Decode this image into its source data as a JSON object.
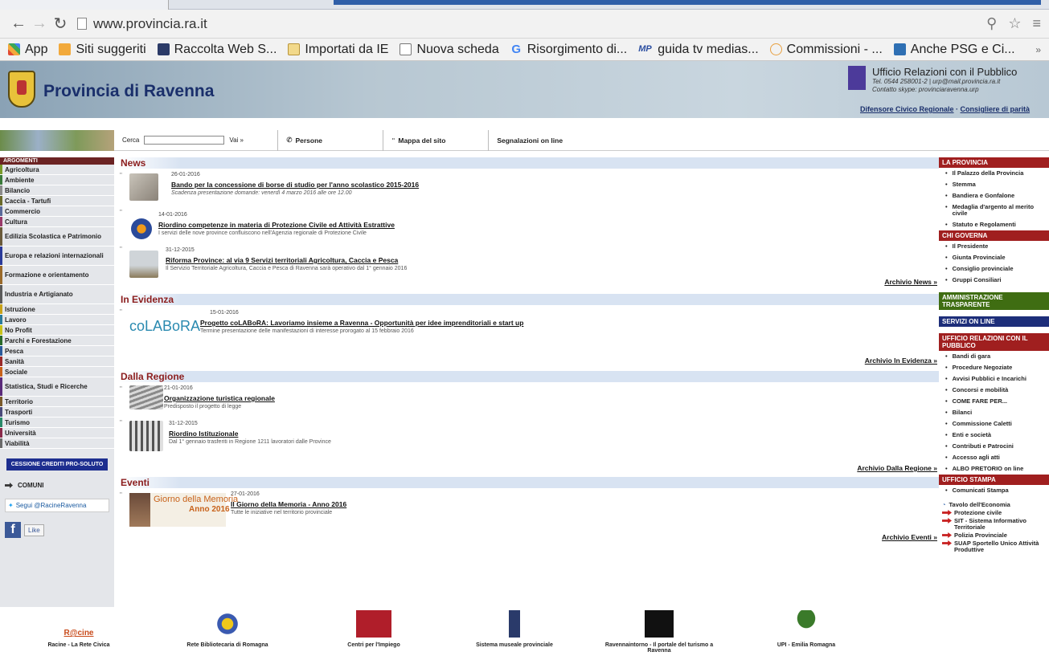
{
  "browser": {
    "url": "www.provincia.ra.it",
    "bookmarks": [
      {
        "label": "App",
        "color": "#e24a32",
        "icon": "apps-icon"
      },
      {
        "label": "Siti suggeriti",
        "color": "#f2a93b",
        "icon": "suggested-sites-icon"
      },
      {
        "label": "Raccolta Web S...",
        "color": "#2b3a67",
        "icon": "web-slice-icon"
      },
      {
        "label": "Importati da IE",
        "color": "#f2d98b",
        "icon": "folder-icon"
      },
      {
        "label": "Nuova scheda",
        "color": "#ffffff",
        "icon": "page-icon"
      },
      {
        "label": "Risorgimento di...",
        "color": "#4285f4",
        "icon": "google-icon"
      },
      {
        "label": "guida tv medias...",
        "color": "#2a4da0",
        "icon": "mp-icon"
      },
      {
        "label": "Commissioni - ...",
        "color": "#e8a040",
        "icon": "mef-icon"
      },
      {
        "label": "Anche PSG e Ci...",
        "color": "#2e6fb3",
        "icon": "news-icon"
      }
    ],
    "bookmarks_more": "»"
  },
  "header": {
    "site_title": "Provincia di Ravenna",
    "urp_title": "Ufficio Relazioni con il Pubblico",
    "urp_tel": "Tel. 0544 258001-2 | urp@mail.provincia.ra.it",
    "urp_skype": "Contatto skype: provinciaravenna.urp",
    "link_difensore": "Difensore Civico Regionale",
    "link_consigliere": "Consigliere di parità",
    "link_sep": " · "
  },
  "toolbar": {
    "search_label": "Cerca",
    "go_label": "Vai »",
    "persone": "Persone",
    "mappa": "Mappa del sito",
    "segnalazioni": "Segnalazioni on line"
  },
  "left": {
    "heading": "ARGOMENTI",
    "items": [
      {
        "label": "Agricoltura",
        "color": "#7a9a2a"
      },
      {
        "label": "Ambiente",
        "color": "#3a7a3a"
      },
      {
        "label": "Bilancio",
        "color": "#8a8a8a"
      },
      {
        "label": "Caccia - Tartufi",
        "color": "#6a6a2a"
      },
      {
        "label": "Commercio",
        "color": "#5a6a9a"
      },
      {
        "label": "Cultura",
        "color": "#9a3a6a"
      },
      {
        "label": "Edilizia Scolastica e Patrimonio",
        "color": "#6a5a3a"
      },
      {
        "label": "Europa e relazioni internazionali",
        "color": "#2a3a9a"
      },
      {
        "label": "Formazione e orientamento",
        "color": "#9a6a2a"
      },
      {
        "label": "Industria e Artigianato",
        "color": "#5a5a5a"
      },
      {
        "label": "Istruzione",
        "color": "#c8a21a"
      },
      {
        "label": "Lavoro",
        "color": "#2a7a9a"
      },
      {
        "label": "No Profit",
        "color": "#c8c21a"
      },
      {
        "label": "Parchi e Forestazione",
        "color": "#2a6a2a"
      },
      {
        "label": "Pesca",
        "color": "#2a5a9a"
      },
      {
        "label": "Sanità",
        "color": "#9a2a2a"
      },
      {
        "label": "Sociale",
        "color": "#c8621a"
      },
      {
        "label": "Statistica, Studi e Ricerche",
        "color": "#5a2a7a"
      },
      {
        "label": "Territorio",
        "color": "#7a5a2a"
      },
      {
        "label": "Trasporti",
        "color": "#4a4a7a"
      },
      {
        "label": "Turismo",
        "color": "#2a8a6a"
      },
      {
        "label": "Università",
        "color": "#8a2a4a"
      },
      {
        "label": "Viabilità",
        "color": "#6a6a6a"
      }
    ],
    "cessione": "CESSIONE CREDITI PRO-SOLUTO",
    "comuni": "COMUNI",
    "twitter": "Segui @RacineRavenna",
    "fb_like": "Like"
  },
  "main": {
    "news": {
      "heading": "News",
      "items": [
        {
          "date": "26-01-2016",
          "title": "Bando per la concessione di borse di studio per l'anno scolastico 2015-2016",
          "sub": "Scadenza presentazione domande: venerdì 4 marzo 2016 alle ore 12.00"
        },
        {
          "date": "14-01-2016",
          "title": "Riordino competenze in materia di Protezione Civile ed Attività Estrattive",
          "sub": "I servizi delle nove province confluiscono nell'Agenzia regionale di Protezione Civile"
        },
        {
          "date": "31-12-2015",
          "title": "Riforma Province: al via 9 Servizi territoriali Agricoltura, Caccia e Pesca",
          "sub": "Il Servizio Territoriale Agricoltura, Caccia e Pesca di Ravenna sarà operativo dal 1° gennaio 2016"
        }
      ],
      "archive": "Archivio News »"
    },
    "evidenza": {
      "heading": "In Evidenza",
      "logo": "coLABoRA",
      "items": [
        {
          "date": "15-01-2016",
          "title": "Progetto coLABoRA: Lavoriamo insieme a Ravenna - Opportunità per idee imprenditoriali e start up",
          "sub": "Termine presentazione delle manifestazioni di interesse prorogato al 15 febbraio 2016"
        }
      ],
      "archive": "Archivio In Evidenza »"
    },
    "regione": {
      "heading": "Dalla Regione",
      "items": [
        {
          "date": "21-01-2016",
          "title": "Organizzazione turistica regionale",
          "sub": "Predisposto il progetto di legge"
        },
        {
          "date": "31-12-2015",
          "title": "Riordino Istituzionale",
          "sub": "Dal 1° gennaio trasferiti in Regione 1211 lavoratori dalle Province"
        }
      ],
      "archive": "Archivio Dalla Regione »"
    },
    "eventi": {
      "heading": "Eventi",
      "banner_title": "Giorno della Memoria",
      "banner_year": "Anno 2016",
      "items": [
        {
          "date": "27-01-2016",
          "title": "Il Giorno della Memoria - Anno 2016",
          "sub": "Tutte le iniziative nel territorio provinciale"
        }
      ],
      "archive": "Archivio Eventi »"
    }
  },
  "right": {
    "la_provincia": {
      "heading": "LA PROVINCIA",
      "color": "#a01f1f",
      "items": [
        "Il Palazzo della Provincia",
        "Stemma",
        "Bandiera e Gonfalone",
        "Medaglia d'argento al merito civile",
        "Statuto e Regolamenti"
      ]
    },
    "chi_governa": {
      "heading": "CHI GOVERNA",
      "color": "#a01f1f",
      "items": [
        "Il Presidente",
        "Giunta Provinciale",
        "Consiglio provinciale",
        "Gruppi Consiliari"
      ]
    },
    "trasparente": {
      "heading": "AMMINISTRAZIONE TRASPARENTE",
      "color": "#3f6d12"
    },
    "servizi": {
      "heading": "SERVIZI ON LINE",
      "color": "#1d2e7a"
    },
    "urp": {
      "heading": "UFFICIO RELAZIONI CON IL PUBBLICO",
      "color": "#a01f1f",
      "items": [
        "Bandi di gara",
        "Procedure Negoziate",
        "Avvisi Pubblici e Incarichi",
        "Concorsi e mobilità",
        "COME FARE PER...",
        "Bilanci",
        "Commissione Caletti",
        "Enti e società",
        "Contributi e Patrocini",
        "Accesso agli atti",
        "ALBO PRETORIO on line"
      ]
    },
    "stampa": {
      "heading": "UFFICIO STAMPA",
      "color": "#a01f1f",
      "items": [
        "Comunicati Stampa"
      ]
    },
    "tavolo": "Tavolo dell'Economia",
    "links": [
      "Protezione civile",
      "SIT - Sistema Informativo Territoriale",
      "Polizia Provinciale",
      "SUAP Sportello Unico Attività Produttive"
    ]
  },
  "footer": {
    "logos": [
      {
        "label": "Racine - La Rete Civica",
        "logo_text": "R@cine",
        "color": "#c84a1a"
      },
      {
        "label": "Rete Bibliotecaria di Romagna",
        "logo_text": "",
        "color": "#3a5ab0"
      },
      {
        "label": "Centri per l'Impiego",
        "logo_text": "",
        "color": "#b01e2a"
      },
      {
        "label": "Sistema museale provinciale",
        "logo_text": "",
        "color": "#2a3a6a"
      },
      {
        "label": "Ravennaintorno - Il portale del turismo a Ravenna",
        "logo_text": "",
        "color": "#111111"
      },
      {
        "label": "UPI - Emilia Romagna",
        "logo_text": "",
        "color": "#3a7a2a"
      }
    ]
  }
}
